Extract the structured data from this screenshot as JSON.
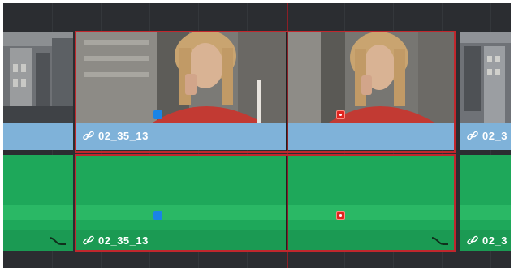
{
  "timeline": {
    "clips": [
      {
        "name": "02_35_13"
      },
      {
        "name": "02_35_13"
      },
      {
        "name": "02_3"
      }
    ]
  },
  "colors": {
    "track_bg": "#2b2d31",
    "video_label": "#7fb2d9",
    "audio_clip": "#1ea85a",
    "selection": "#c0272d",
    "playhead": "#8b1f26",
    "marker_blue": "#1a84e6",
    "marker_red": "#e0241f"
  },
  "icons": {
    "link": "link-icon",
    "audio_fade": "fade-curve-icon"
  }
}
